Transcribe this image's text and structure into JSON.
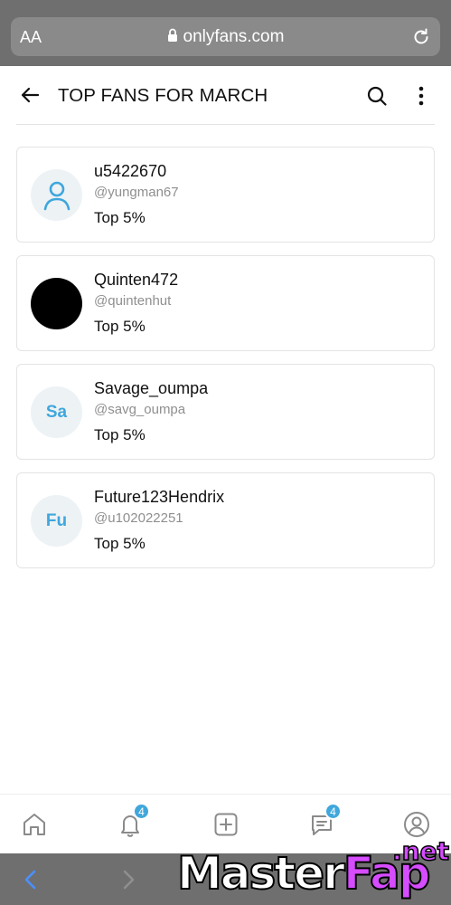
{
  "browser": {
    "text_size_label": "AA",
    "url": "onlyfans.com"
  },
  "header": {
    "title": "TOP FANS FOR MARCH"
  },
  "fans": [
    {
      "name": "u5422670",
      "handle": "@yungman67",
      "rank": "Top 5%",
      "avatar": {
        "type": "default-user-icon",
        "initials": ""
      }
    },
    {
      "name": "Quinten472",
      "handle": "@quintenhut",
      "rank": "Top 5%",
      "avatar": {
        "type": "photo",
        "initials": ""
      }
    },
    {
      "name": "Savage_oumpa",
      "handle": "@savg_oumpa",
      "rank": "Top 5%",
      "avatar": {
        "type": "initials",
        "initials": "Sa"
      }
    },
    {
      "name": "Future123Hendrix",
      "handle": "@u102022251",
      "rank": "Top 5%",
      "avatar": {
        "type": "initials",
        "initials": "Fu"
      }
    }
  ],
  "bottom_nav": {
    "items": [
      {
        "icon": "home-icon"
      },
      {
        "icon": "bell-icon",
        "badge": "4"
      },
      {
        "icon": "plus-square-icon"
      },
      {
        "icon": "message-icon",
        "badge": "4"
      },
      {
        "icon": "profile-icon"
      }
    ]
  },
  "watermark": {
    "main_a": "Master",
    "main_b": "Fap",
    "suffix": ".net"
  },
  "colors": {
    "accent": "#3fa7dc",
    "browser_chrome": "#6f6f6f",
    "watermark_pink": "#d64cff"
  }
}
